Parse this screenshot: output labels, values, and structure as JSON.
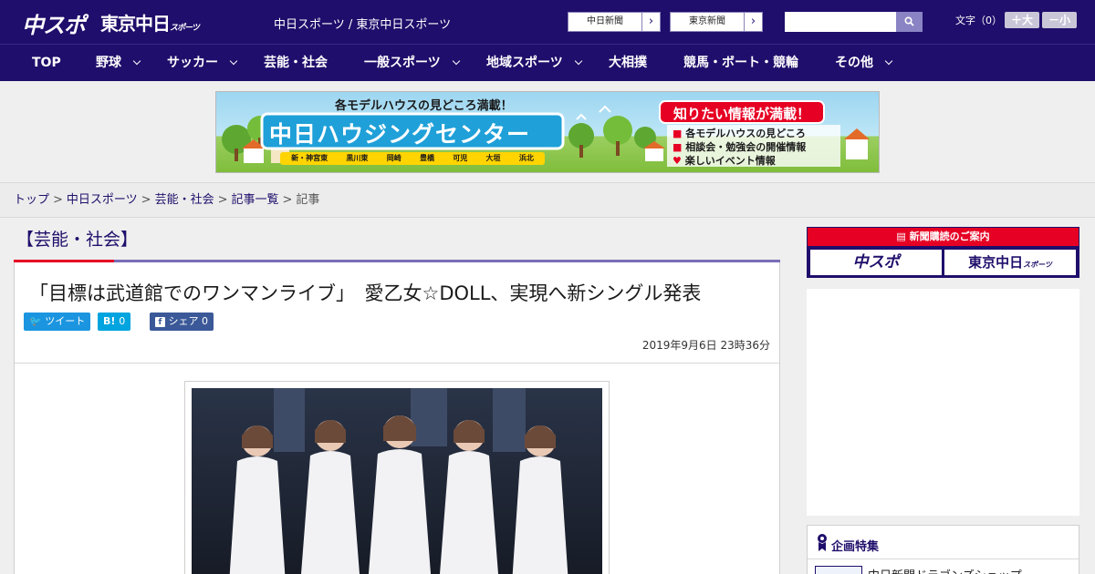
{
  "header": {
    "logo_chuspo": "中スポ",
    "logo_tokyo": "東京中日",
    "logo_tokyo_sub": "スポーツ",
    "tagline": "中日スポーツ / 東京中日スポーツ",
    "paper_buttons": [
      "中日新聞",
      "東京新聞"
    ],
    "search_placeholder": "",
    "font_size_label": "文字（0）",
    "font_larger": "＋大",
    "font_smaller": "－小"
  },
  "nav": {
    "items": [
      {
        "label": "TOP",
        "dropdown": false
      },
      {
        "label": "野球",
        "dropdown": true
      },
      {
        "label": "サッカー",
        "dropdown": true
      },
      {
        "label": "芸能・社会",
        "dropdown": false
      },
      {
        "label": "一般スポーツ",
        "dropdown": true
      },
      {
        "label": "地域スポーツ",
        "dropdown": true
      },
      {
        "label": "大相撲",
        "dropdown": false
      },
      {
        "label": "競馬・ボート・競輪",
        "dropdown": false
      },
      {
        "label": "その他",
        "dropdown": true
      }
    ]
  },
  "ad_banner": {
    "top_text": "各モデルハウスの見どころ満載！",
    "main_text": "中日ハウジングセンター",
    "callout": "知りたい情報が満載！",
    "bullets": [
      "各モデルハウスの見どころ",
      "相談会・勉強会の開催情報",
      "楽しいイベント情報"
    ],
    "locations": [
      "新・神宮東",
      "黒川東",
      "岡崎",
      "豊橋",
      "可児",
      "大垣",
      "浜北"
    ]
  },
  "breadcrumb": {
    "items": [
      "トップ",
      "中日スポーツ",
      "芸能・社会",
      "記事一覧"
    ],
    "current": "記事",
    "separator": ">"
  },
  "article": {
    "category": "【芸能・社会】",
    "headline": "「目標は武道館でのワンマンライブ」　愛乙女☆DOLL、実現へ新シングル発表",
    "share": {
      "tweet_label": "ツイート",
      "hatena_label": "B!",
      "hatena_count": "0",
      "facebook_label": "シェア",
      "facebook_count": "0"
    },
    "date": "2019年9月6日 23時36分"
  },
  "sidebar": {
    "subscribe_header": "新聞購読のご案内",
    "subscribe_left": "中スポ",
    "subscribe_right": "東京中日",
    "subscribe_right_sub": "スポーツ",
    "feature_title": "企画特集",
    "feature_item": "中日新聞ドラゴンズショップ"
  },
  "colors": {
    "brand_navy": "#1f0e6b",
    "accent_red": "#e60023",
    "twitter_blue": "#1b95e0",
    "hatena_blue": "#00a4de",
    "facebook_blue": "#3b5998"
  }
}
